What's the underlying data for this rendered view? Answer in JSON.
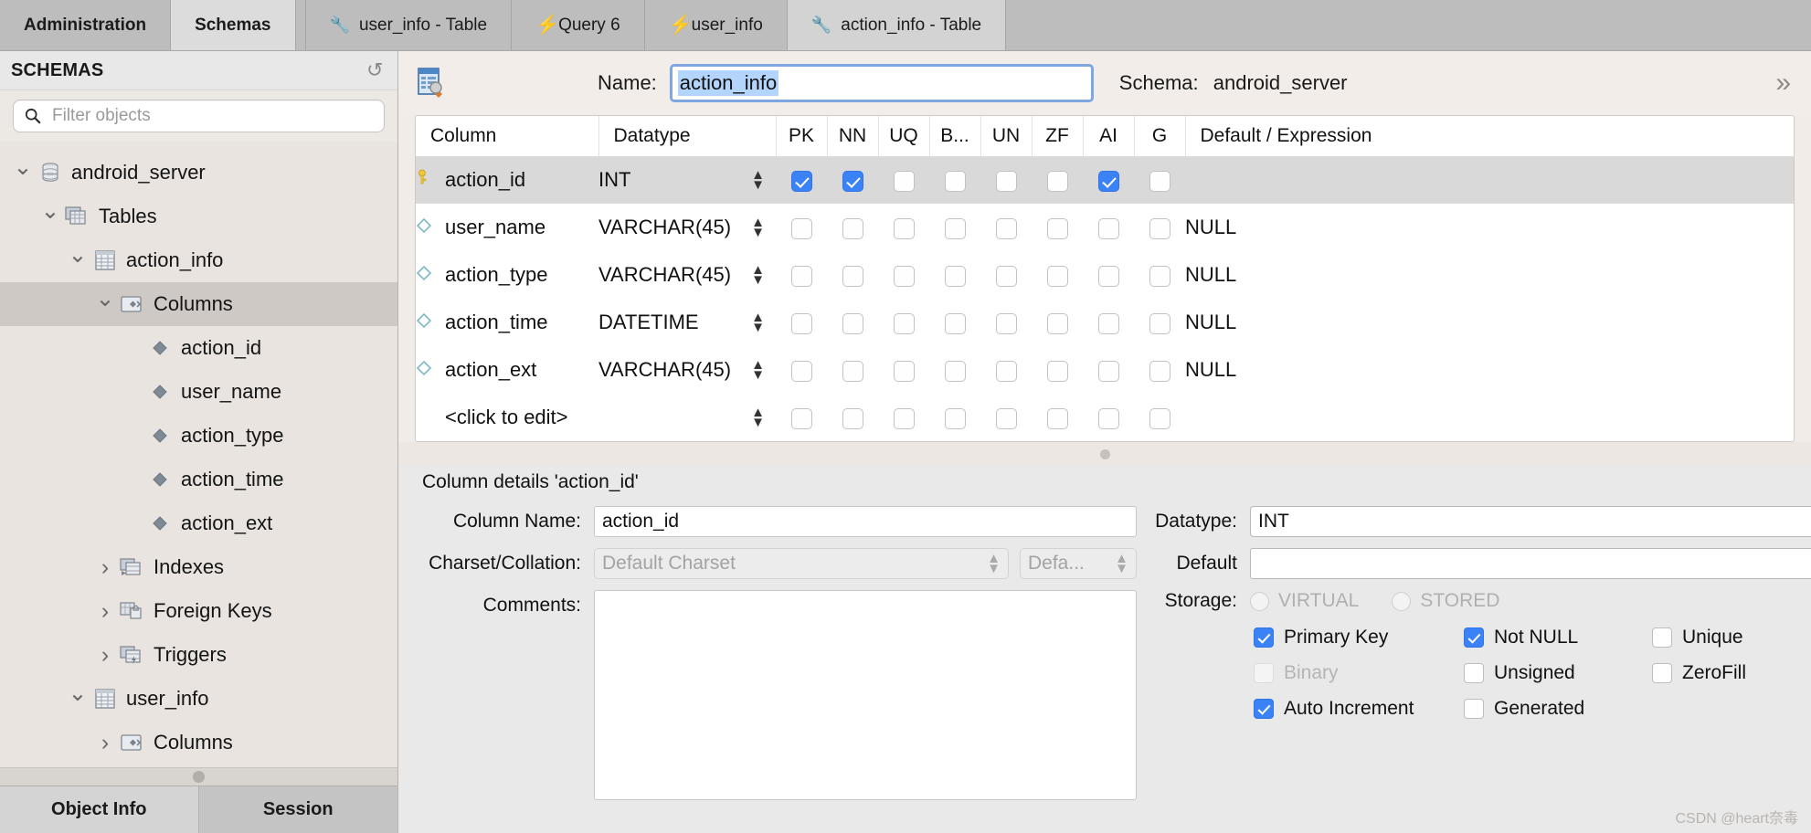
{
  "tabs": [
    {
      "label": "Administration",
      "icon": "none",
      "state": "inactive-bold"
    },
    {
      "label": "Schemas",
      "icon": "none",
      "state": "active-bold"
    },
    {
      "label": "user_info - Table",
      "icon": "wrench-icon",
      "state": "inactive"
    },
    {
      "label": "Query 6",
      "icon": "bolt-icon",
      "state": "inactive"
    },
    {
      "label": "user_info",
      "icon": "bolt-icon",
      "state": "inactive"
    },
    {
      "label": "action_info - Table",
      "icon": "wrench-icon",
      "state": "active"
    }
  ],
  "sidebar": {
    "title": "SCHEMAS",
    "refresh_icon": "refresh-icon",
    "search": {
      "placeholder": "Filter objects",
      "value": "",
      "icon": "search-icon"
    },
    "tree": [
      {
        "label": "android_server",
        "icon": "database-icon",
        "indent": 0,
        "expander": "down",
        "selected": false
      },
      {
        "label": "Tables",
        "icon": "tables-folder-icon",
        "indent": 1,
        "expander": "down",
        "selected": false
      },
      {
        "label": "action_info",
        "icon": "table-icon",
        "indent": 2,
        "expander": "down",
        "selected": false
      },
      {
        "label": "Columns",
        "icon": "columns-folder-icon",
        "indent": 3,
        "expander": "down",
        "selected": true
      },
      {
        "label": "action_id",
        "icon": "column-diamond-icon",
        "indent": 4,
        "expander": "none",
        "selected": false
      },
      {
        "label": "user_name",
        "icon": "column-diamond-icon",
        "indent": 4,
        "expander": "none",
        "selected": false
      },
      {
        "label": "action_type",
        "icon": "column-diamond-icon",
        "indent": 4,
        "expander": "none",
        "selected": false
      },
      {
        "label": "action_time",
        "icon": "column-diamond-icon",
        "indent": 4,
        "expander": "none",
        "selected": false
      },
      {
        "label": "action_ext",
        "icon": "column-diamond-icon",
        "indent": 4,
        "expander": "none",
        "selected": false
      },
      {
        "label": "Indexes",
        "icon": "indexes-folder-icon",
        "indent": 3,
        "expander": "right",
        "selected": false
      },
      {
        "label": "Foreign Keys",
        "icon": "foreignkeys-folder-icon",
        "indent": 3,
        "expander": "right",
        "selected": false
      },
      {
        "label": "Triggers",
        "icon": "triggers-folder-icon",
        "indent": 3,
        "expander": "right",
        "selected": false
      },
      {
        "label": "user_info",
        "icon": "table-icon",
        "indent": 2,
        "expander": "down",
        "selected": false
      },
      {
        "label": "Columns",
        "icon": "columns-folder-icon",
        "indent": 3,
        "expander": "right",
        "selected": false
      }
    ],
    "bottom_tabs": [
      {
        "label": "Object Info",
        "active": true
      },
      {
        "label": "Session",
        "active": false
      }
    ]
  },
  "editor": {
    "table_icon": "table-edit-icon",
    "name_label": "Name:",
    "name_value": "action_info",
    "schema_label": "Schema:",
    "schema_value": "android_server",
    "collapse_icon": "chevron-double-down-icon",
    "grid": {
      "headers": [
        "Column",
        "Datatype",
        "PK",
        "NN",
        "UQ",
        "B...",
        "UN",
        "ZF",
        "AI",
        "G",
        "Default / Expression"
      ],
      "rows": [
        {
          "column": "action_id",
          "icon": "primary-key-icon",
          "datatype": "INT",
          "pk": true,
          "nn": true,
          "uq": false,
          "b": false,
          "un": false,
          "zf": false,
          "ai": true,
          "g": false,
          "default": "",
          "selected": true
        },
        {
          "column": "user_name",
          "icon": "column-diamond-icon",
          "datatype": "VARCHAR(45)",
          "pk": false,
          "nn": false,
          "uq": false,
          "b": false,
          "un": false,
          "zf": false,
          "ai": false,
          "g": false,
          "default": "NULL",
          "selected": false
        },
        {
          "column": "action_type",
          "icon": "column-diamond-icon",
          "datatype": "VARCHAR(45)",
          "pk": false,
          "nn": false,
          "uq": false,
          "b": false,
          "un": false,
          "zf": false,
          "ai": false,
          "g": false,
          "default": "NULL",
          "selected": false
        },
        {
          "column": "action_time",
          "icon": "column-diamond-icon",
          "datatype": "DATETIME",
          "pk": false,
          "nn": false,
          "uq": false,
          "b": false,
          "un": false,
          "zf": false,
          "ai": false,
          "g": false,
          "default": "NULL",
          "selected": false
        },
        {
          "column": "action_ext",
          "icon": "column-diamond-icon",
          "datatype": "VARCHAR(45)",
          "pk": false,
          "nn": false,
          "uq": false,
          "b": false,
          "un": false,
          "zf": false,
          "ai": false,
          "g": false,
          "default": "NULL",
          "selected": false
        },
        {
          "column": "<click to edit>",
          "icon": "none",
          "datatype": "",
          "pk": false,
          "nn": false,
          "uq": false,
          "b": false,
          "un": false,
          "zf": false,
          "ai": false,
          "g": false,
          "default": "",
          "selected": false,
          "placeholder": true
        }
      ]
    },
    "details": {
      "title": "Column details 'action_id'",
      "column_name_label": "Column Name:",
      "column_name_value": "action_id",
      "charset_label": "Charset/Collation:",
      "charset_value": "Default Charset",
      "collation_value": "Defa...",
      "comments_label": "Comments:",
      "comments_value": "",
      "datatype_label": "Datatype:",
      "datatype_value": "INT",
      "default_label": "Default",
      "default_value": "",
      "storage_label": "Storage:",
      "storage_virtual": "VIRTUAL",
      "storage_stored": "STORED",
      "flags": [
        {
          "label": "Primary Key",
          "checked": true,
          "disabled": false
        },
        {
          "label": "Not NULL",
          "checked": true,
          "disabled": false
        },
        {
          "label": "Unique",
          "checked": false,
          "disabled": false
        },
        {
          "label": "Binary",
          "checked": false,
          "disabled": true
        },
        {
          "label": "Unsigned",
          "checked": false,
          "disabled": false
        },
        {
          "label": "ZeroFill",
          "checked": false,
          "disabled": false
        },
        {
          "label": "Auto Increment",
          "checked": true,
          "disabled": false
        },
        {
          "label": "Generated",
          "checked": false,
          "disabled": false
        }
      ]
    }
  },
  "watermark": "CSDN @heart奈毒",
  "colors": {
    "accent": "#3b82f7",
    "selection": "#b4d5fb",
    "focus_border": "#7ea6e0"
  }
}
